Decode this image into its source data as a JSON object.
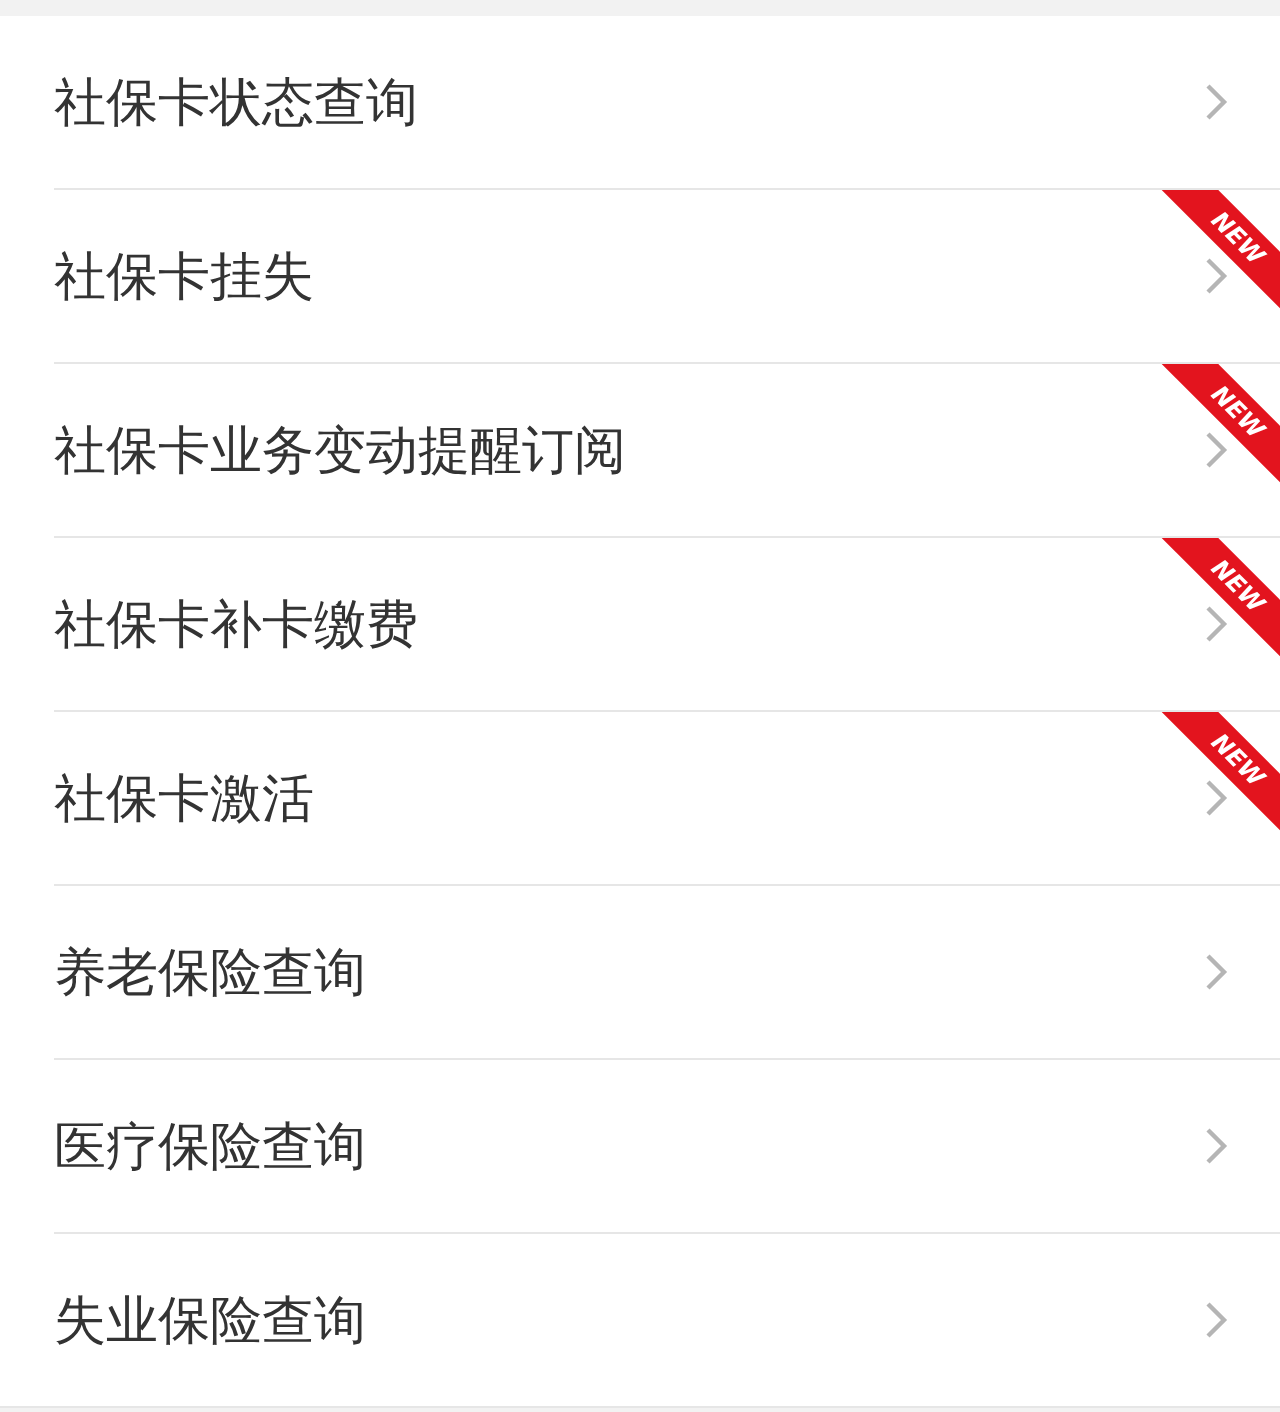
{
  "menu_items": [
    {
      "label": "社保卡状态查询"
    },
    {
      "label": "社保卡挂失",
      "badge": "NEW"
    },
    {
      "label": "社保卡业务变动提醒订阅",
      "badge": "NEW"
    },
    {
      "label": "社保卡补卡缴费",
      "badge": "NEW"
    },
    {
      "label": "社保卡激活",
      "badge": "NEW"
    },
    {
      "label": "养老保险查询"
    },
    {
      "label": "医疗保险查询"
    },
    {
      "label": "失业保险查询"
    }
  ]
}
